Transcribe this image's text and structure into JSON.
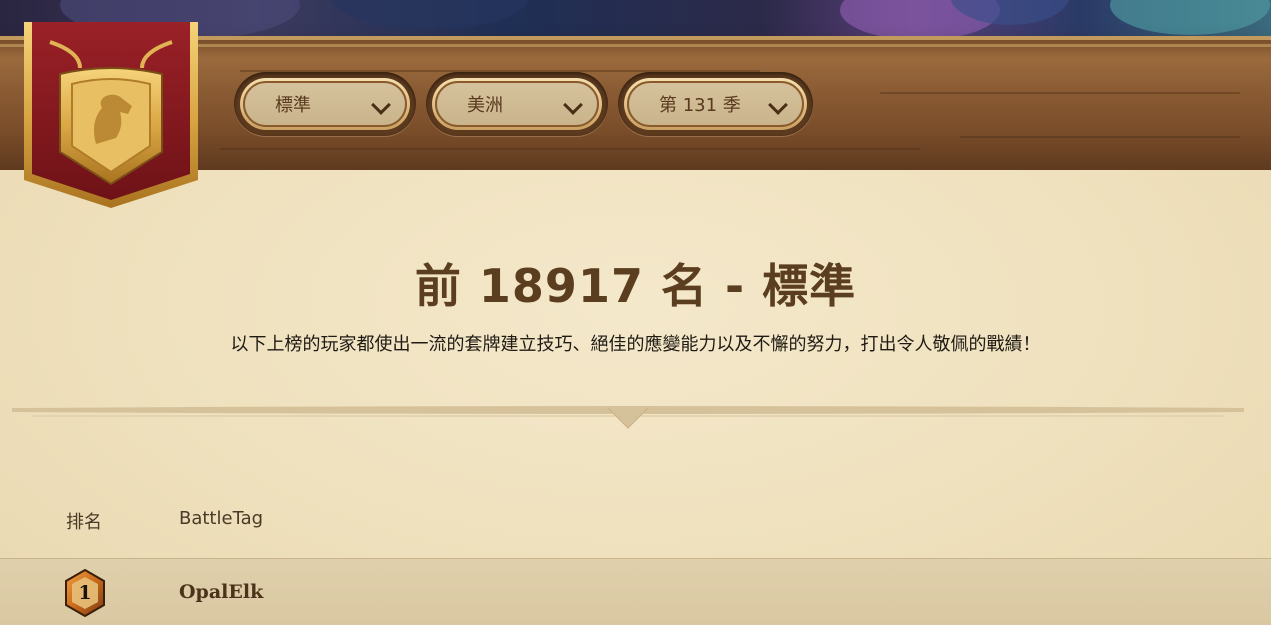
{
  "filters": {
    "mode": "標準",
    "region": "美洲",
    "season": "第 131 季"
  },
  "heading": {
    "title": "前 18917 名 - 標準",
    "subtitle": "以下上榜的玩家都使出一流的套牌建立技巧、絕佳的應變能力以及不懈的努力，打出令人敬佩的戰績！"
  },
  "table": {
    "columns": [
      "排名",
      "BattleTag"
    ],
    "rows": [
      {
        "rank": "1",
        "battletag": "OpalElk"
      }
    ]
  },
  "icons": {
    "banner": "horse-crest-icon",
    "dropdown": "chevron-down-icon",
    "rank": "rank-hexagon-badge-icon"
  },
  "colors": {
    "wood": "#8a5b33",
    "parchment": "#efe1bd",
    "title": "#5b3d1f",
    "banner_red": "#8e1f24",
    "gold": "#d9ab4a"
  }
}
